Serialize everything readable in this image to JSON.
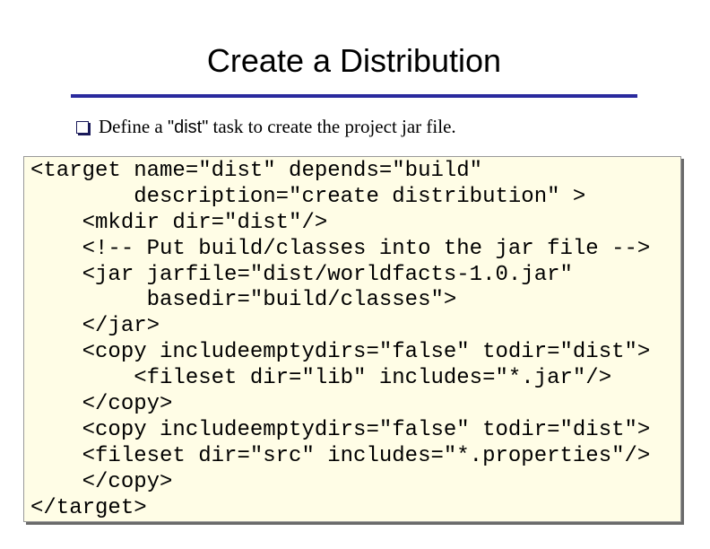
{
  "slide": {
    "title": "Create a Distribution",
    "bullet": {
      "prefix": "Define a ",
      "code_word": "\"dist\"",
      "suffix": " task to create the project jar file."
    },
    "code_lines": [
      "<target name=\"dist\" depends=\"build\"",
      "        description=\"create distribution\" >",
      "    <mkdir dir=\"dist\"/>",
      "    <!-- Put build/classes into the jar file -->",
      "    <jar jarfile=\"dist/worldfacts-1.0.jar\"",
      "         basedir=\"build/classes\">",
      "    </jar>",
      "    <copy includeemptydirs=\"false\" todir=\"dist\">",
      "        <fileset dir=\"lib\" includes=\"*.jar\"/>",
      "    </copy>",
      "    <copy includeemptydirs=\"false\" todir=\"dist\">",
      "    <fileset dir=\"src\" includes=\"*.properties\"/>",
      "    </copy>",
      "</target>"
    ]
  },
  "colors": {
    "title_rule": "#2a2a9e",
    "code_background": "#fffde6",
    "code_border": "#999999"
  },
  "icons": {
    "bullet": "hollow-square-bullet-icon"
  }
}
